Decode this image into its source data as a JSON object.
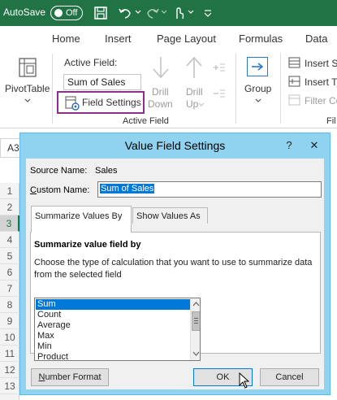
{
  "titlebar": {
    "autosave_label": "AutoSave",
    "autosave_state": "Off"
  },
  "tabs": [
    "Home",
    "Insert",
    "Page Layout",
    "Formulas",
    "Data"
  ],
  "ribbon": {
    "pivottable_label": "PivotTable",
    "active_field_label": "Active Field:",
    "active_field_value": "Sum of Sales",
    "field_settings_label": "Field Settings",
    "drill_down_1": "Drill",
    "drill_down_2": "Down",
    "drill_up_1": "Drill",
    "drill_up_2": "Up",
    "group_label": "Group",
    "active_field_group": "Active Field",
    "insert_slicer": "Insert Sl",
    "insert_timeline": "Insert T",
    "filter_connections": "Filter Co",
    "fil": "Fil"
  },
  "namebox": "A3",
  "rows": [
    "1",
    "2",
    "3",
    "4",
    "5",
    "6",
    "7",
    "8",
    "9",
    "10",
    "11",
    "12",
    "13"
  ],
  "dialog": {
    "title": "Value Field Settings",
    "help": "?",
    "close": "✕",
    "source_name_label": "Source Name:",
    "source_name_value": "Sales",
    "custom_name_label_pre": "",
    "custom_name_label_u": "C",
    "custom_name_label_post": "ustom Name:",
    "custom_name_value": "Sum of Sales",
    "tab_summarize": "Summarize Values By",
    "tab_show": "Show Values As",
    "section_title": "Summarize value field by",
    "description": "Choose the type of calculation that you want to use to summarize data from the selected field",
    "options": [
      "Sum",
      "Count",
      "Average",
      "Max",
      "Min",
      "Product"
    ],
    "selected_option": "Sum",
    "number_format_u": "N",
    "number_format_rest": "umber Format",
    "ok": "OK",
    "cancel": "Cancel"
  },
  "colors": {
    "excel_green": "#217346",
    "dialog_border": "#8fd3f0",
    "highlight_purple": "#8b2f8b",
    "selection_blue": "#0078d7"
  }
}
